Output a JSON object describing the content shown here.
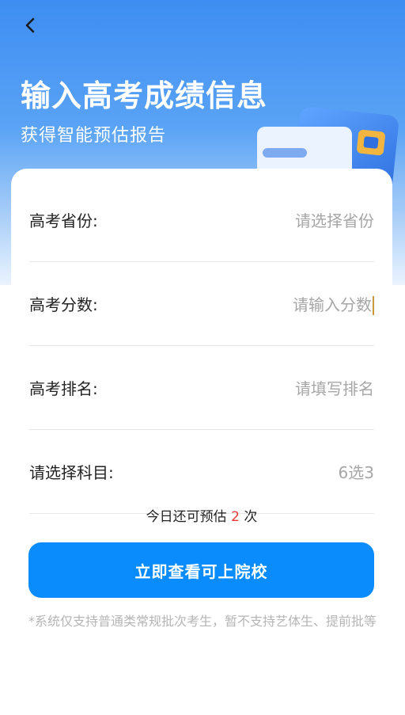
{
  "header": {
    "back_icon": "chevron-left-icon",
    "title": "输入高考成绩信息",
    "subtitle": "获得智能预估报告"
  },
  "form": {
    "province": {
      "label": "高考省份:",
      "placeholder": "请选择省份"
    },
    "score": {
      "label": "高考分数:",
      "placeholder": "请输入分数"
    },
    "rank": {
      "label": "高考排名:",
      "placeholder": "请填写排名"
    },
    "subjects": {
      "label": "请选择科目:",
      "value": "6选3"
    }
  },
  "notice": {
    "prefix": "今日还可预估",
    "count": "2",
    "suffix": "次"
  },
  "cta": {
    "label": "立即查看可上院校"
  },
  "disclaimer": "*系统仅支持普通类常规批次考生，暂不支持艺体生、提前批等",
  "colors": {
    "primary": "#0a8cfc",
    "hero_top": "#3d8df2",
    "highlight": "#e53935"
  }
}
